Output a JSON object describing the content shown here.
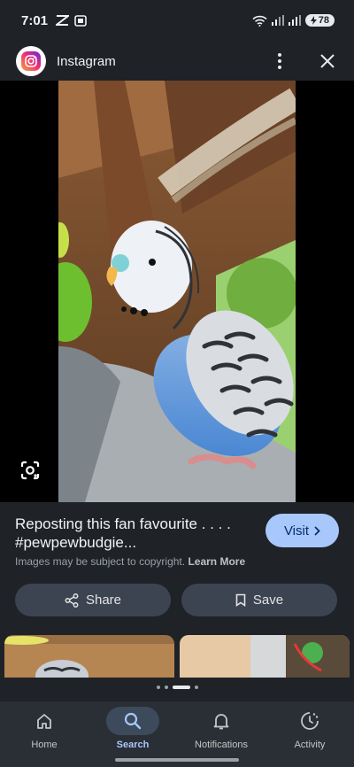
{
  "status_bar": {
    "time": "7:01",
    "battery": "78"
  },
  "header": {
    "app_name": "Instagram"
  },
  "result": {
    "title_line1": "Reposting this fan favourite . . . .",
    "title_line2": "#pewpewbudgie...",
    "visit_label": "Visit",
    "copyright_text": "Images may be subject to copyright.",
    "learn_more_label": "Learn More"
  },
  "actions": {
    "share_label": "Share",
    "save_label": "Save"
  },
  "bottom_nav": {
    "items": [
      {
        "label": "Home",
        "icon": "home-icon"
      },
      {
        "label": "Search",
        "icon": "search-icon",
        "active": true
      },
      {
        "label": "Notifications",
        "icon": "bell-icon"
      },
      {
        "label": "Activity",
        "icon": "activity-icon"
      }
    ]
  },
  "colors": {
    "accent": "#a8c7fa",
    "background": "#1f2227",
    "button": "#3c4452"
  }
}
